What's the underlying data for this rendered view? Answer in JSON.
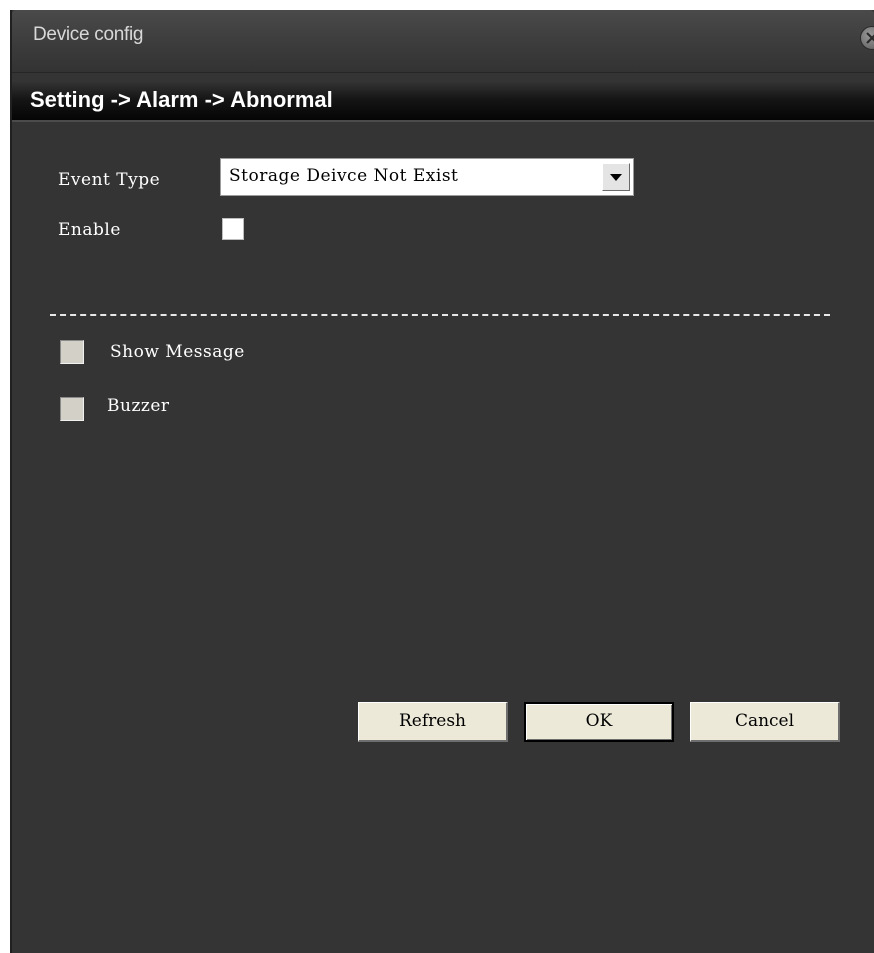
{
  "window": {
    "title": "Device config",
    "close_icon": "close-icon"
  },
  "breadcrumb": "Setting -> Alarm -> Abnormal",
  "form": {
    "event_type_label": "Event Type",
    "event_type_value": "Storage Deivce Not Exist",
    "enable_label": "Enable",
    "enable_checked": false
  },
  "actions": {
    "show_message_label": "Show Message",
    "show_message_checked": false,
    "buzzer_label": "Buzzer",
    "buzzer_checked": false
  },
  "buttons": {
    "refresh": "Refresh",
    "ok": "OK",
    "cancel": "Cancel"
  },
  "colors": {
    "panel_bg": "#343434",
    "titlebar": "#3b3b3b",
    "breadcrumb_bg": "#050505",
    "button_face": "#ece9d8"
  }
}
